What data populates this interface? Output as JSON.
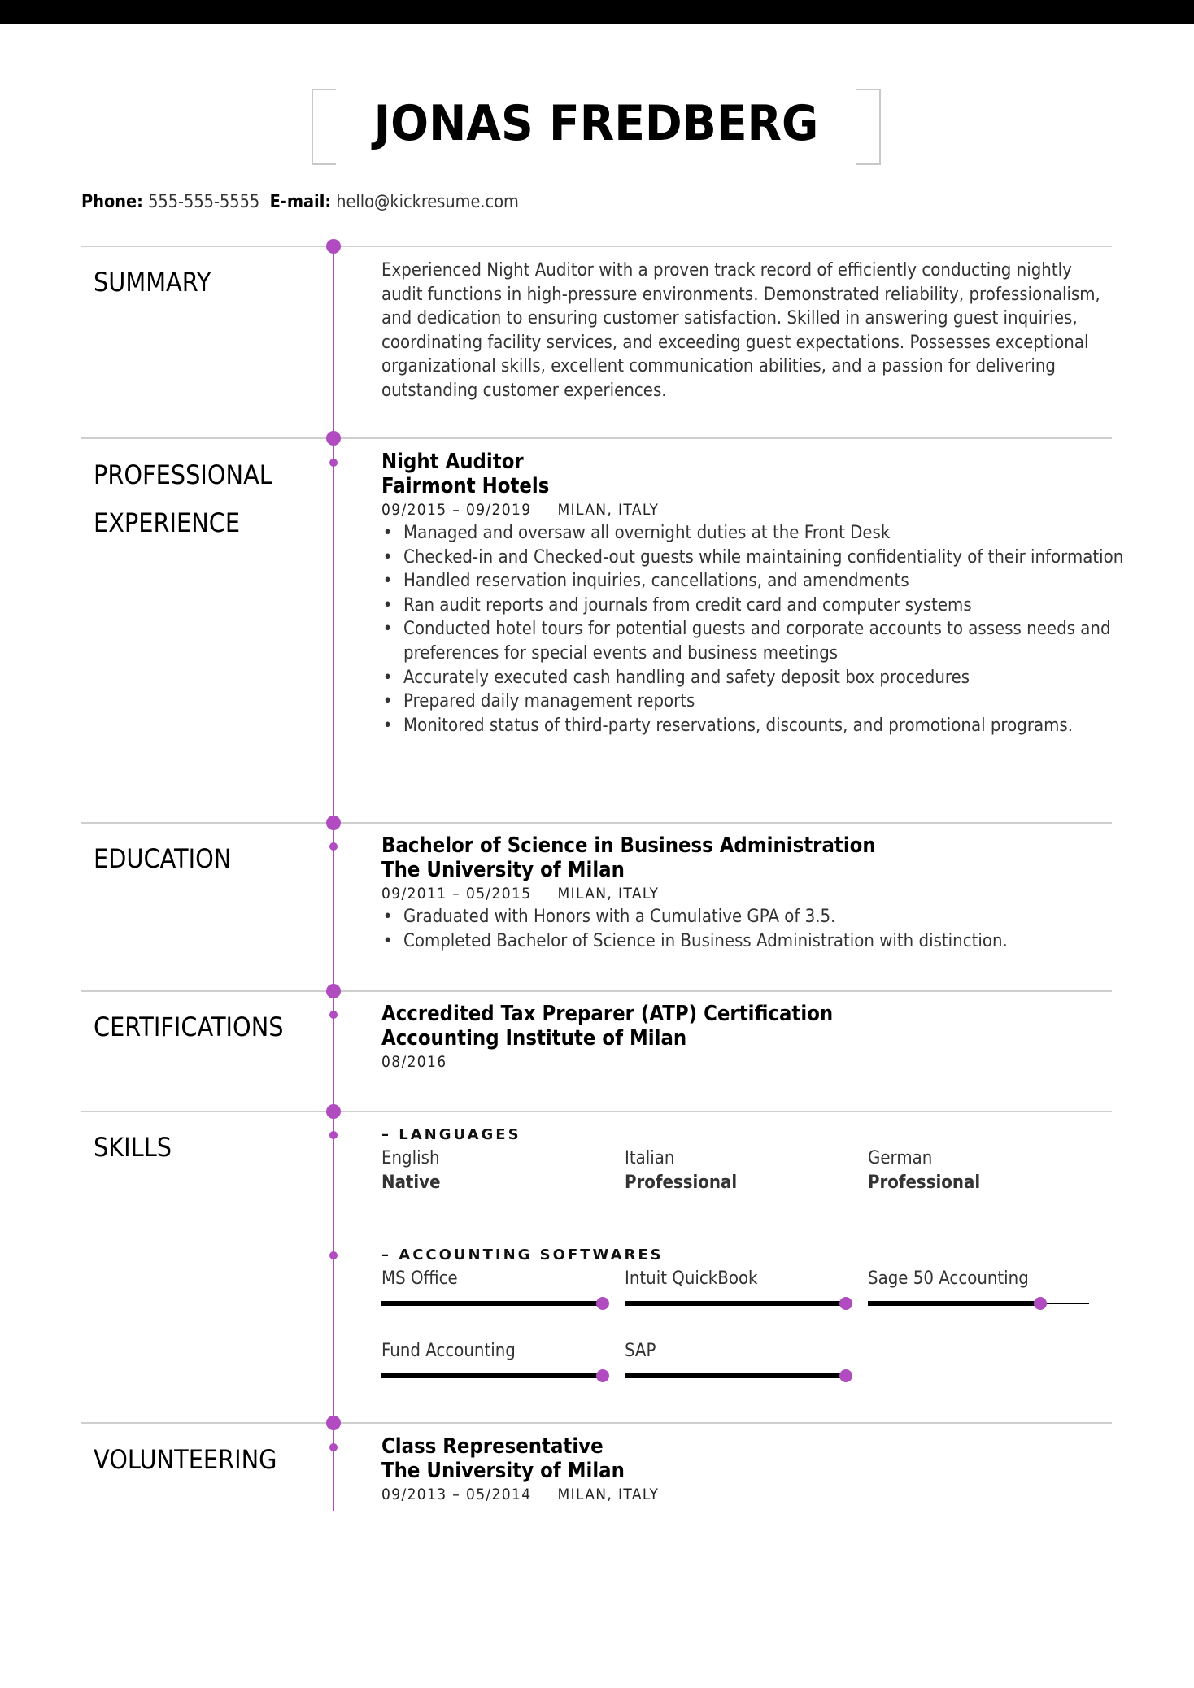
{
  "header": {
    "name": "JONAS FREDBERG",
    "phone_label": "Phone:",
    "phone": "555-555-5555",
    "email_label": "E-mail:",
    "email": "hello@kickresume.com"
  },
  "accent_color": "#b04bc0",
  "sections": {
    "summary": {
      "title": "SUMMARY",
      "text": "Experienced Night Auditor with a proven track record of efficiently conducting nightly audit functions in high-pressure environments. Demonstrated reliability, professionalism, and dedication to ensuring customer satisfaction. Skilled in answering guest inquiries, coordinating facility services, and exceeding guest expectations. Possesses exceptional organizational skills, excellent communication abilities, and a passion for delivering outstanding customer experiences."
    },
    "experience": {
      "title_line1": "PROFESSIONAL",
      "title_line2": "EXPERIENCE",
      "entries": [
        {
          "role": "Night Auditor",
          "org": "Fairmont Hotels",
          "dates": "09/2015 – 09/2019",
          "location": "MILAN, ITALY",
          "bullets": [
            "Managed and oversaw all overnight duties at the Front Desk",
            "Checked-in and Checked-out guests while maintaining confidentiality of their information",
            "Handled reservation inquiries, cancellations, and amendments",
            "Ran audit reports and journals from credit card and computer systems",
            "Conducted hotel tours for potential guests and corporate accounts to assess needs and preferences for special events and business meetings",
            "Accurately executed cash handling and safety deposit box procedures",
            "Prepared daily management reports",
            "Monitored status of third-party reservations, discounts, and promotional programs."
          ]
        }
      ]
    },
    "education": {
      "title": "EDUCATION",
      "entries": [
        {
          "degree": "Bachelor of Science in Business Administration",
          "school": "The University of Milan",
          "dates": "09/2011 – 05/2015",
          "location": "MILAN, ITALY",
          "bullets": [
            "Graduated with Honors with a Cumulative GPA of 3.5.",
            "Completed Bachelor of Science in Business Administration with distinction."
          ]
        }
      ]
    },
    "certifications": {
      "title": "CERTIFICATIONS",
      "entries": [
        {
          "name": "Accredited Tax Preparer (ATP) Certification",
          "issuer": "Accounting Institute of Milan",
          "date": "08/2016"
        }
      ]
    },
    "skills": {
      "title": "SKILLS",
      "languages": {
        "heading": "– LANGUAGES",
        "items": [
          {
            "name": "English",
            "level": "Native"
          },
          {
            "name": "Italian",
            "level": "Professional"
          },
          {
            "name": "German",
            "level": "Professional"
          }
        ]
      },
      "software": {
        "heading": "– ACCOUNTING SOFTWARES",
        "items": [
          {
            "name": "MS Office",
            "level": 1.0
          },
          {
            "name": "Intuit QuickBook",
            "level": 1.0
          },
          {
            "name": "Sage 50 Accounting",
            "level": 0.78
          },
          {
            "name": "Fund Accounting",
            "level": 1.0
          },
          {
            "name": "SAP",
            "level": 1.0
          }
        ]
      }
    },
    "volunteering": {
      "title": "VOLUNTEERING",
      "entries": [
        {
          "role": "Class Representative",
          "org": "The University of Milan",
          "dates": "09/2013 – 05/2014",
          "location": "MILAN, ITALY"
        }
      ]
    }
  }
}
